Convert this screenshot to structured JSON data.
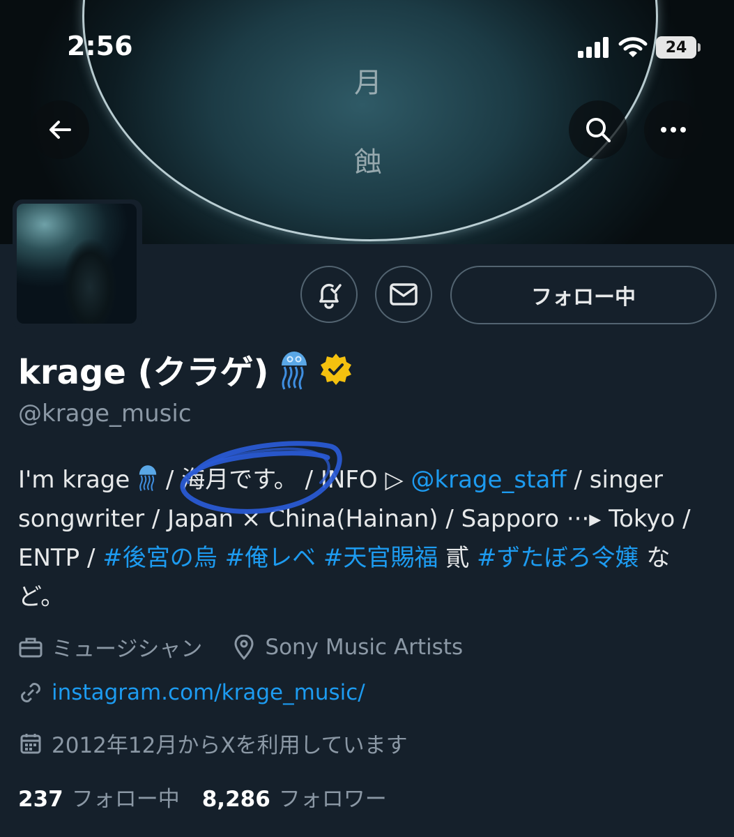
{
  "status_bar": {
    "time": "2:56",
    "battery": "24",
    "icons": [
      "signal-icon",
      "wifi-icon",
      "battery-icon"
    ]
  },
  "banner": {
    "kanji_top": "月",
    "kanji_bottom": "蝕"
  },
  "nav": {
    "back_icon": "arrow-left-icon",
    "search_icon": "search-icon",
    "more_icon": "more-icon"
  },
  "actions": {
    "notify_icon": "bell-check-icon",
    "message_icon": "mail-icon",
    "follow_label": "フォロー中"
  },
  "profile": {
    "name": "krage (クラゲ)",
    "name_emoji": "jellyfish-emoji",
    "verified_color": "#f4c10f",
    "handle": "@krage_music"
  },
  "bio": {
    "part1": "I'm krage ",
    "part2": " / 海月です。 / INFO ▷ ",
    "mention": "@krage_staff",
    "part3": " / singer songwriter / Japan × China(Hainan) / Sapporo ···▸ Tokyo / ENTP / ",
    "tag1": "#後宮の烏",
    "tag2": "#俺レベ",
    "tag3": "#天官賜福",
    "part4": " 貳 ",
    "tag4": "#ずたぼろ令嬢",
    "part5": " など。"
  },
  "meta": {
    "category": "ミュージシャン",
    "location": "Sony Music Artists",
    "website": "instagram.com/krage_music/",
    "joined": "2012年12月からXを利用しています"
  },
  "stats": {
    "following_count": "237",
    "following_label": "フォロー中",
    "followers_count": "8,286",
    "followers_label": "フォロワー"
  },
  "colors": {
    "background": "#15202b",
    "link": "#1d9bf0",
    "muted": "#8b98a5",
    "annotation": "#2a5bd7"
  }
}
